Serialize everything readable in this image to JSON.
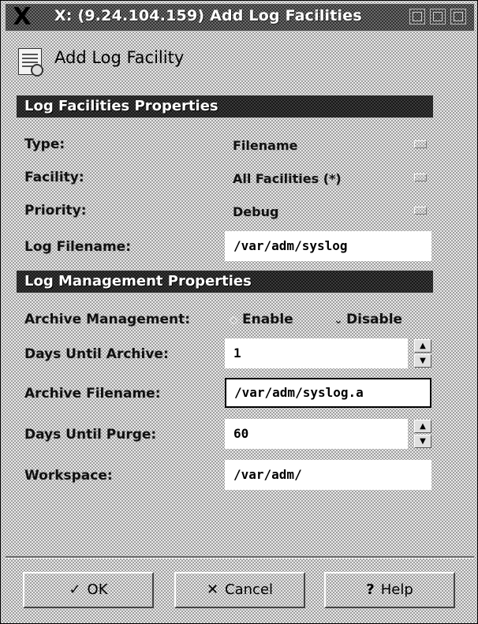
{
  "window": {
    "title": "X: (9.24.104.159) Add Log Facilities",
    "menu_glyph": "X"
  },
  "header": {
    "title": "Add Log Facility"
  },
  "log_facilities": {
    "section_title": "Log Facilities Properties",
    "type_label": "Type:",
    "type_value": "Filename",
    "facility_label": "Facility:",
    "facility_value": "All Facilities (*)",
    "priority_label": "Priority:",
    "priority_value": "Debug",
    "filename_label": "Log Filename:",
    "filename_value": "/var/adm/syslog"
  },
  "log_management": {
    "section_title": "Log Management Properties",
    "archive_mgmt_label": "Archive Management:",
    "enable_label": "Enable",
    "disable_label": "Disable",
    "selected": "enable",
    "days_archive_label": "Days Until Archive:",
    "days_archive_value": "1",
    "archive_filename_label": "Archive Filename:",
    "archive_filename_value": "/var/adm/syslog.a",
    "days_purge_label": "Days Until Purge:",
    "days_purge_value": "60",
    "workspace_label": "Workspace:",
    "workspace_value": "/var/adm/"
  },
  "buttons": {
    "ok": "OK",
    "cancel": "Cancel",
    "help": "Help"
  },
  "icons": {
    "ok": "check-icon",
    "cancel": "x-icon",
    "help": "question-icon"
  }
}
